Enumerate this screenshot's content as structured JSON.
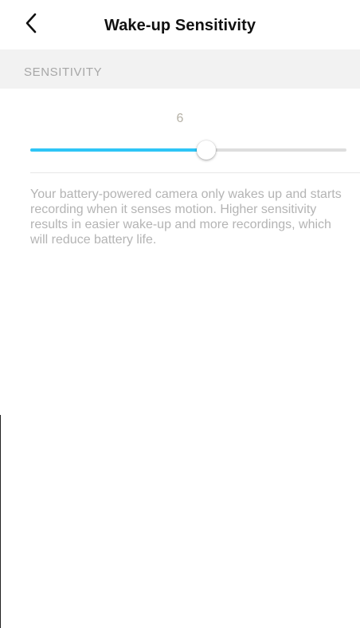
{
  "navbar": {
    "title": "Wake-up Sensitivity",
    "back_icon": "chevron-left-icon"
  },
  "section": {
    "header": "SENSITIVITY"
  },
  "slider": {
    "value": "6",
    "min": 1,
    "max": 10,
    "fill_color": "#2ec5f6",
    "track_color": "#dedede"
  },
  "description": "Your battery-powered camera only wakes up and starts recording when it senses motion. Higher sensitivity results in easier wake-up and more recordings, which will reduce battery life."
}
